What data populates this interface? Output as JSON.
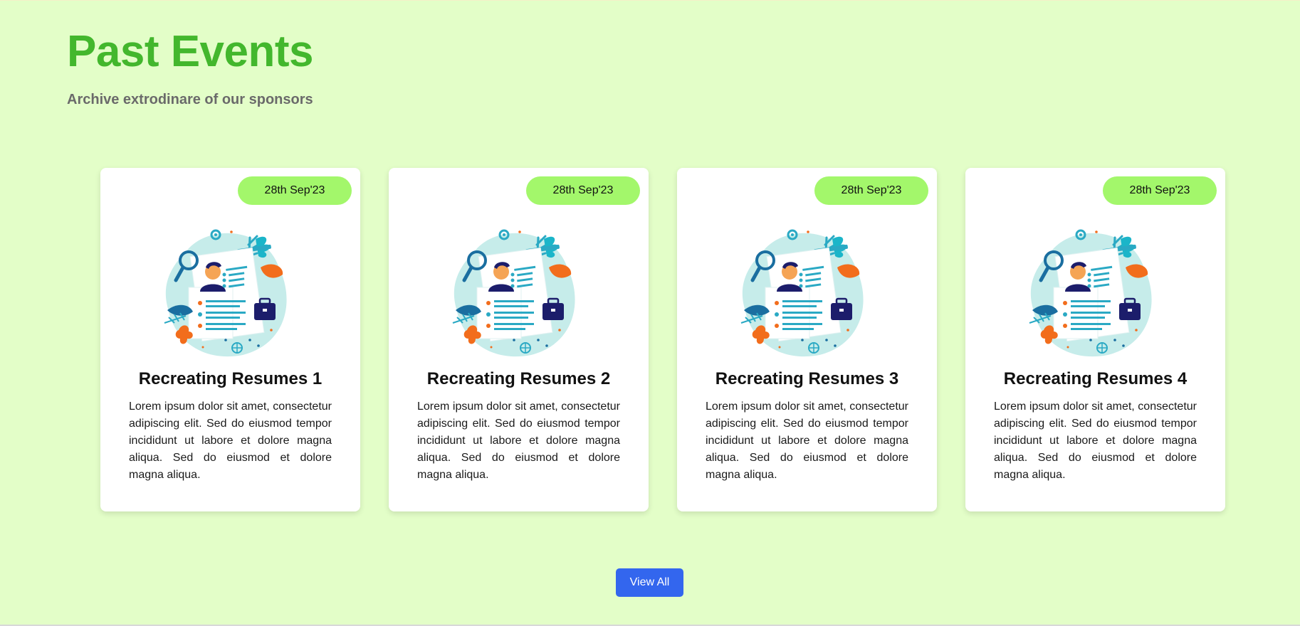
{
  "header": {
    "title": "Past Events",
    "subtitle": "Archive extrodinare of our sponsors"
  },
  "events": [
    {
      "date": "28th Sep'23",
      "title": "Recreating Resumes 1",
      "description": "Lorem ipsum dolor sit amet, consectetur adipiscing elit. Sed do eiusmod tempor incididunt ut labore et dolore magna aliqua. Sed do eiusmod et dolore magna aliqua."
    },
    {
      "date": "28th Sep'23",
      "title": "Recreating Resumes 2",
      "description": "Lorem ipsum dolor sit amet, consectetur adipiscing elit. Sed do eiusmod tempor incididunt ut labore et dolore magna aliqua. Sed do eiusmod et dolore magna aliqua."
    },
    {
      "date": "28th Sep'23",
      "title": "Recreating Resumes 3",
      "description": "Lorem ipsum dolor sit amet, consectetur adipiscing elit. Sed do eiusmod tempor incididunt ut labore et dolore magna aliqua. Sed do eiusmod et dolore magna aliqua."
    },
    {
      "date": "28th Sep'23",
      "title": "Recreating Resumes 4",
      "description": "Lorem ipsum dolor sit amet, consectetur adipiscing elit. Sed do eiusmod tempor incididunt ut labore et dolore magna aliqua. Sed do eiusmod et dolore magna aliqua."
    }
  ],
  "actions": {
    "view_all_label": "View All"
  },
  "icons": {
    "event_illustration": "resume-illustration-icon"
  },
  "colors": {
    "background": "#e3fec8",
    "title": "#43b72d",
    "badge": "#a3f76b",
    "button": "#3366ee"
  }
}
